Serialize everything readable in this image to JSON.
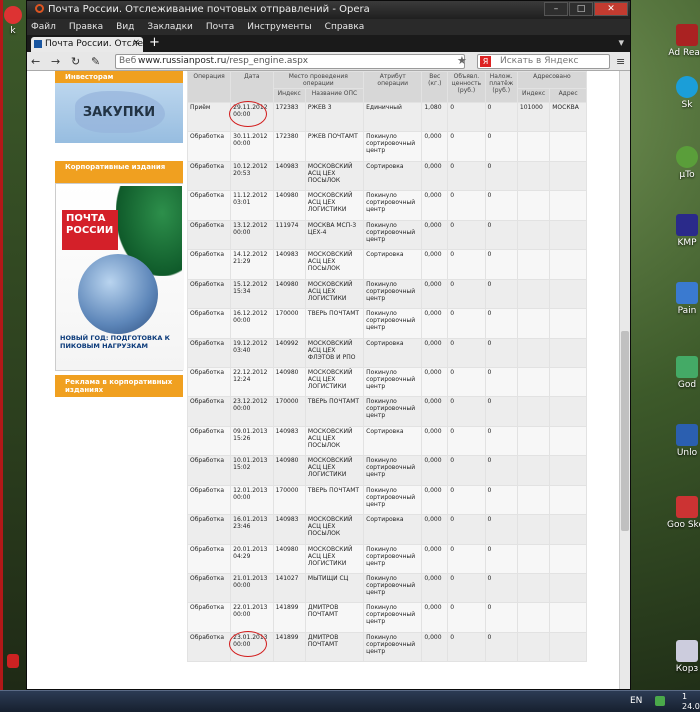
{
  "window": {
    "title": "Почта России. Отслеживание почтовых отправлений - Opera",
    "controls": {
      "minimize": "–",
      "maximize": "□",
      "close": "✕"
    }
  },
  "menu": [
    "Файл",
    "Правка",
    "Вид",
    "Закладки",
    "Почта",
    "Инструменты",
    "Справка"
  ],
  "tab": {
    "label": "Почта России. Отсле...",
    "close": "×",
    "new_tab": "+"
  },
  "nav": {
    "back": "←",
    "forward": "→",
    "reload": "↻",
    "edit": "✎",
    "security_label": "Веб",
    "address_host": "www.russianpost.ru",
    "address_path": "/resp_engine.aspx",
    "search_placeholder": "Искать в Яндекс",
    "search_engine": "Я"
  },
  "sidebar": {
    "investors": "Инвесторам",
    "banner_text": "ЗАКУПКИ",
    "corporate": "Корпоративные издания",
    "poster_logo": "ПОЧТА РОССИИ",
    "poster_caption": "НОВЫЙ ГОД: ПОДГОТОВКА К ПИКОВЫМ НАГРУЗКАМ",
    "ads": "Реклама в корпоративных изданиях"
  },
  "table": {
    "headers": {
      "operation": "Операция",
      "date": "Дата",
      "place": "Место проведения операции",
      "index": "Индекс",
      "ops_name": "Название ОПС",
      "attribute": "Атрибут операции",
      "weight": "Вес (кг.)",
      "declared": "Объявл. ценность (руб.)",
      "cod": "Налож. платёж (руб.)",
      "addressed": "Адресовано",
      "addr_index": "Индекс",
      "address": "Адрес"
    },
    "rows": [
      {
        "op": "Приём",
        "date": "29.11.2012 00:00",
        "index": "172383",
        "name": "РЖЕВ 3",
        "attr": "Единичный",
        "weight": "1,080",
        "declared": "0",
        "cod": "0",
        "addr_index": "101000",
        "addr": "МОСКВА",
        "circled": true
      },
      {
        "op": "Обработка",
        "date": "30.11.2012 00:00",
        "index": "172380",
        "name": "РЖЕВ ПОЧТАМТ",
        "attr": "Покинуло сортировочный центр",
        "weight": "0,000",
        "declared": "0",
        "cod": "0",
        "addr_index": "",
        "addr": ""
      },
      {
        "op": "Обработка",
        "date": "10.12.2012 20:53",
        "index": "140983",
        "name": "МОСКОВСКИЙ АСЦ ЦЕХ ПОСЫЛОК",
        "attr": "Сортировка",
        "weight": "0,000",
        "declared": "0",
        "cod": "0",
        "addr_index": "",
        "addr": ""
      },
      {
        "op": "Обработка",
        "date": "11.12.2012 03:01",
        "index": "140980",
        "name": "МОСКОВСКИЙ АСЦ ЦЕХ ЛОГИСТИКИ",
        "attr": "Покинуло сортировочный центр",
        "weight": "0,000",
        "declared": "0",
        "cod": "0",
        "addr_index": "",
        "addr": ""
      },
      {
        "op": "Обработка",
        "date": "13.12.2012 00:00",
        "index": "111974",
        "name": "МОСКВА МСП-3 ЦЕХ-4",
        "attr": "Покинуло сортировочный центр",
        "weight": "0,000",
        "declared": "0",
        "cod": "0",
        "addr_index": "",
        "addr": ""
      },
      {
        "op": "Обработка",
        "date": "14.12.2012 21:29",
        "index": "140983",
        "name": "МОСКОВСКИЙ АСЦ ЦЕХ ПОСЫЛОК",
        "attr": "Сортировка",
        "weight": "0,000",
        "declared": "0",
        "cod": "0",
        "addr_index": "",
        "addr": ""
      },
      {
        "op": "Обработка",
        "date": "15.12.2012 15:34",
        "index": "140980",
        "name": "МОСКОВСКИЙ АСЦ ЦЕХ ЛОГИСТИКИ",
        "attr": "Покинуло сортировочный центр",
        "weight": "0,000",
        "declared": "0",
        "cod": "0",
        "addr_index": "",
        "addr": ""
      },
      {
        "op": "Обработка",
        "date": "16.12.2012 00:00",
        "index": "170000",
        "name": "ТВЕРЬ ПОЧТАМТ",
        "attr": "Покинуло сортировочный центр",
        "weight": "0,000",
        "declared": "0",
        "cod": "0",
        "addr_index": "",
        "addr": ""
      },
      {
        "op": "Обработка",
        "date": "19.12.2012 03:40",
        "index": "140992",
        "name": "МОСКОВСКИЙ АСЦ ЦЕХ ФЛЭТОВ И РПО",
        "attr": "Сортировка",
        "weight": "0,000",
        "declared": "0",
        "cod": "0",
        "addr_index": "",
        "addr": ""
      },
      {
        "op": "Обработка",
        "date": "22.12.2012 12:24",
        "index": "140980",
        "name": "МОСКОВСКИЙ АСЦ ЦЕХ ЛОГИСТИКИ",
        "attr": "Покинуло сортировочный центр",
        "weight": "0,000",
        "declared": "0",
        "cod": "0",
        "addr_index": "",
        "addr": ""
      },
      {
        "op": "Обработка",
        "date": "23.12.2012 00:00",
        "index": "170000",
        "name": "ТВЕРЬ ПОЧТАМТ",
        "attr": "Покинуло сортировочный центр",
        "weight": "0,000",
        "declared": "0",
        "cod": "0",
        "addr_index": "",
        "addr": ""
      },
      {
        "op": "Обработка",
        "date": "09.01.2013 15:26",
        "index": "140983",
        "name": "МОСКОВСКИЙ АСЦ ЦЕХ ПОСЫЛОК",
        "attr": "Сортировка",
        "weight": "0,000",
        "declared": "0",
        "cod": "0",
        "addr_index": "",
        "addr": ""
      },
      {
        "op": "Обработка",
        "date": "10.01.2013 15:02",
        "index": "140980",
        "name": "МОСКОВСКИЙ АСЦ ЦЕХ ЛОГИСТИКИ",
        "attr": "Покинуло сортировочный центр",
        "weight": "0,000",
        "declared": "0",
        "cod": "0",
        "addr_index": "",
        "addr": ""
      },
      {
        "op": "Обработка",
        "date": "12.01.2013 00:00",
        "index": "170000",
        "name": "ТВЕРЬ ПОЧТАМТ",
        "attr": "Покинуло сортировочный центр",
        "weight": "0,000",
        "declared": "0",
        "cod": "0",
        "addr_index": "",
        "addr": ""
      },
      {
        "op": "Обработка",
        "date": "16.01.2013 23:46",
        "index": "140983",
        "name": "МОСКОВСКИЙ АСЦ ЦЕХ ПОСЫЛОК",
        "attr": "Сортировка",
        "weight": "0,000",
        "declared": "0",
        "cod": "0",
        "addr_index": "",
        "addr": ""
      },
      {
        "op": "Обработка",
        "date": "20.01.2013 04:29",
        "index": "140980",
        "name": "МОСКОВСКИЙ АСЦ ЦЕХ ЛОГИСТИКИ",
        "attr": "Покинуло сортировочный центр",
        "weight": "0,000",
        "declared": "0",
        "cod": "0",
        "addr_index": "",
        "addr": ""
      },
      {
        "op": "Обработка",
        "date": "21.01.2013 00:00",
        "index": "141027",
        "name": "МЫТИЩИ СЦ",
        "attr": "Покинуло сортировочный центр",
        "weight": "0,000",
        "declared": "0",
        "cod": "0",
        "addr_index": "",
        "addr": ""
      },
      {
        "op": "Обработка",
        "date": "22.01.2013 00:00",
        "index": "141899",
        "name": "ДМИТРОВ ПОЧТАМТ",
        "attr": "Покинуло сортировочный центр",
        "weight": "0,000",
        "declared": "0",
        "cod": "0",
        "addr_index": "",
        "addr": ""
      },
      {
        "op": "Обработка",
        "date": "23.01.2013 00:00",
        "index": "141899",
        "name": "ДМИТРОВ ПОЧТАМТ",
        "attr": "Покинуло сортировочный центр",
        "weight": "0,000",
        "declared": "0",
        "cod": "0",
        "addr_index": "",
        "addr": "",
        "circled": true
      }
    ]
  },
  "desktop_icons": [
    {
      "label": "k",
      "color": "#d33"
    },
    {
      "label": "Ad Read",
      "color": "#a22"
    },
    {
      "label": "Sk",
      "color": "#1b9ed8"
    },
    {
      "label": "µTo",
      "color": "#5a9e3a"
    },
    {
      "label": "KMP",
      "color": "#2a2a8a"
    },
    {
      "label": "Pain",
      "color": "#3a7ad0"
    },
    {
      "label": "God",
      "color": "#4a6"
    },
    {
      "label": "Unlo",
      "color": "#2b5fb0"
    },
    {
      "label": "Goo Sketc",
      "color": "#c33"
    },
    {
      "label": "Корз",
      "color": "#ccd"
    }
  ],
  "taskbar": {
    "lang": "EN",
    "time": "1",
    "date": "24.0"
  }
}
